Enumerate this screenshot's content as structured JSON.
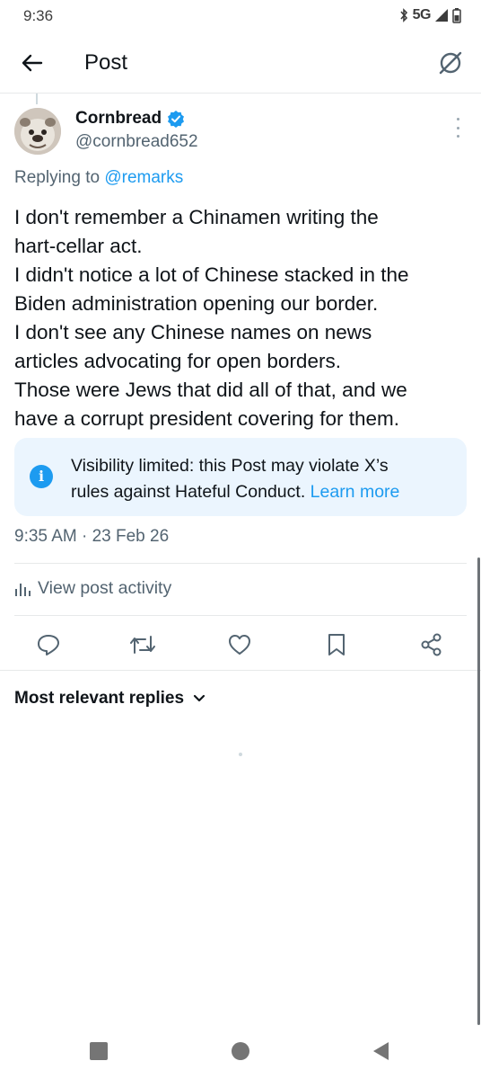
{
  "status_bar": {
    "time": "9:36",
    "network": "5G",
    "icons": [
      "bluetooth-icon",
      "signal-icon",
      "battery-icon"
    ]
  },
  "header": {
    "title": "Post",
    "back_icon": "arrow-left-icon",
    "grok_icon": "grok-icon"
  },
  "post": {
    "author_name": "Cornbread",
    "author_handle": "@cornbread652",
    "verified": true,
    "replying_prefix": "Replying to ",
    "replying_to": "@remarks",
    "body_lines": [
      "I don't remember a Chinamen writing the",
      "hart-cellar act.",
      "I didn't notice a lot of Chinese stacked in the",
      "Biden administration opening our border.",
      "I don't see any Chinese names on news",
      "articles advocating for open borders.",
      "Those were Jews that did all of that, and we",
      "have a corrupt president covering for them."
    ],
    "notice": {
      "line1": "Visibility limited: this Post may violate X’s",
      "line2": "rules against Hateful Conduct. ",
      "link": "Learn more"
    },
    "timestamp": "9:35 AM · 23 Feb 26",
    "activity_label": "View post activity"
  },
  "actions": [
    "reply-icon",
    "repost-icon",
    "like-icon",
    "bookmark-icon",
    "share-icon"
  ],
  "replies": {
    "sort_label": "Most relevant replies"
  },
  "colors": {
    "accent": "#1d9bf0",
    "secondary_text": "#536471",
    "notice_bg": "#ebf5fe",
    "divider": "#e7e9ea"
  }
}
